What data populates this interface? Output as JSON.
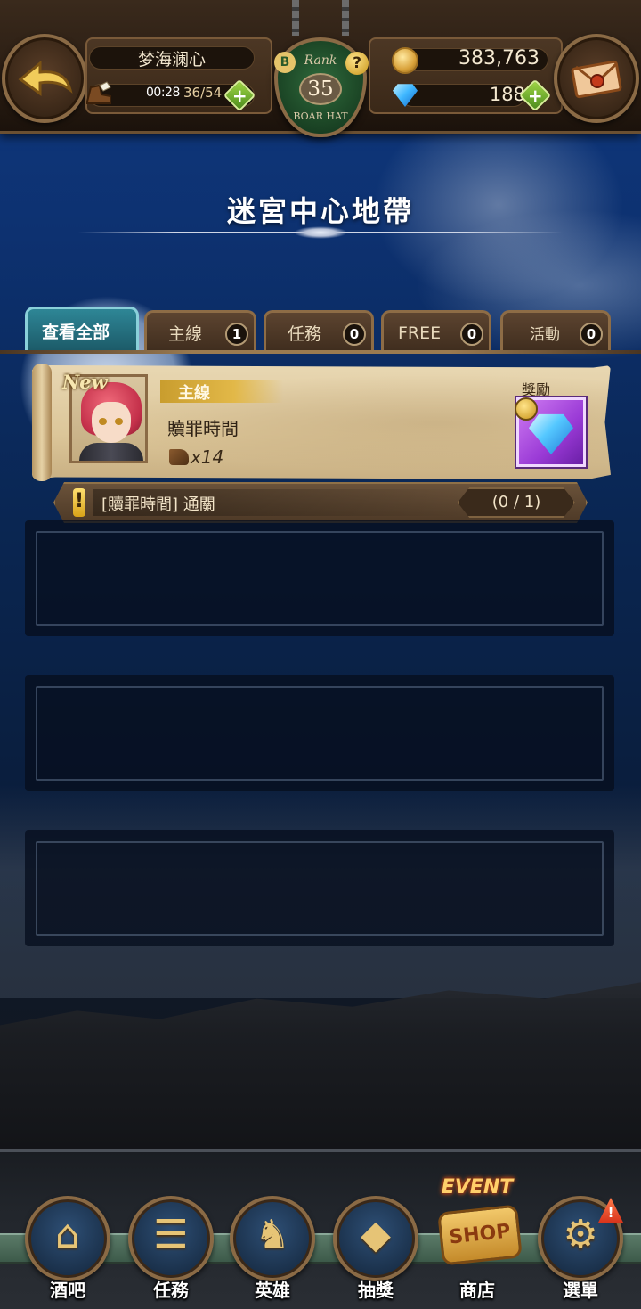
{
  "header": {
    "player_name": "梦海澜心",
    "stamina_timer": "00:28",
    "stamina": "36/54",
    "rank_label": "Rank",
    "rank_value": "35",
    "rank_emblem_text": "BOAR HAT",
    "rank_letter": "B",
    "help_symbol": "?",
    "gold": "383,763",
    "gems": "188",
    "plus_symbol": "+"
  },
  "stage_title": "迷宮中心地帶",
  "tabs": [
    {
      "label": "查看全部",
      "count": null,
      "active": true
    },
    {
      "label": "主線",
      "count": "1",
      "active": false
    },
    {
      "label": "任務",
      "count": "0",
      "active": false
    },
    {
      "label": "FREE",
      "count": "0",
      "active": false
    },
    {
      "label": "活動",
      "count": "0",
      "active": false
    }
  ],
  "quests": [
    {
      "new_tag": "New",
      "type": "主線",
      "name": "贖罪時間",
      "stamina_cost": "x14",
      "reward_label": "獎勵",
      "reward_icon": "diamond-gem-icon",
      "condition": "[贖罪時間] 通關",
      "condition_marker": "!",
      "progress": "(0 / 1)"
    }
  ],
  "bottom_nav": [
    {
      "label": "酒吧",
      "icon": "tavern-icon",
      "glyph": "⌂"
    },
    {
      "label": "任務",
      "icon": "scroll-icon",
      "glyph": "☰"
    },
    {
      "label": "英雄",
      "icon": "helmet-icon",
      "glyph": "♞"
    },
    {
      "label": "抽獎",
      "icon": "crystal-icon",
      "glyph": "◆"
    },
    {
      "label": "商店",
      "icon": "shop-icon",
      "glyph": ""
    },
    {
      "label": "選單",
      "icon": "gear-icon",
      "glyph": "⚙"
    }
  ],
  "event_shop": {
    "event_text": "EVENT",
    "shop_text": "SHOP"
  },
  "menu_alert": "!",
  "colors": {
    "active_tab": "#2e8696",
    "parchment": "#e8d7b2",
    "ribbon_gold": "#e2b848",
    "plus_green": "#7cbf34",
    "night_sky": "#0d3170"
  }
}
